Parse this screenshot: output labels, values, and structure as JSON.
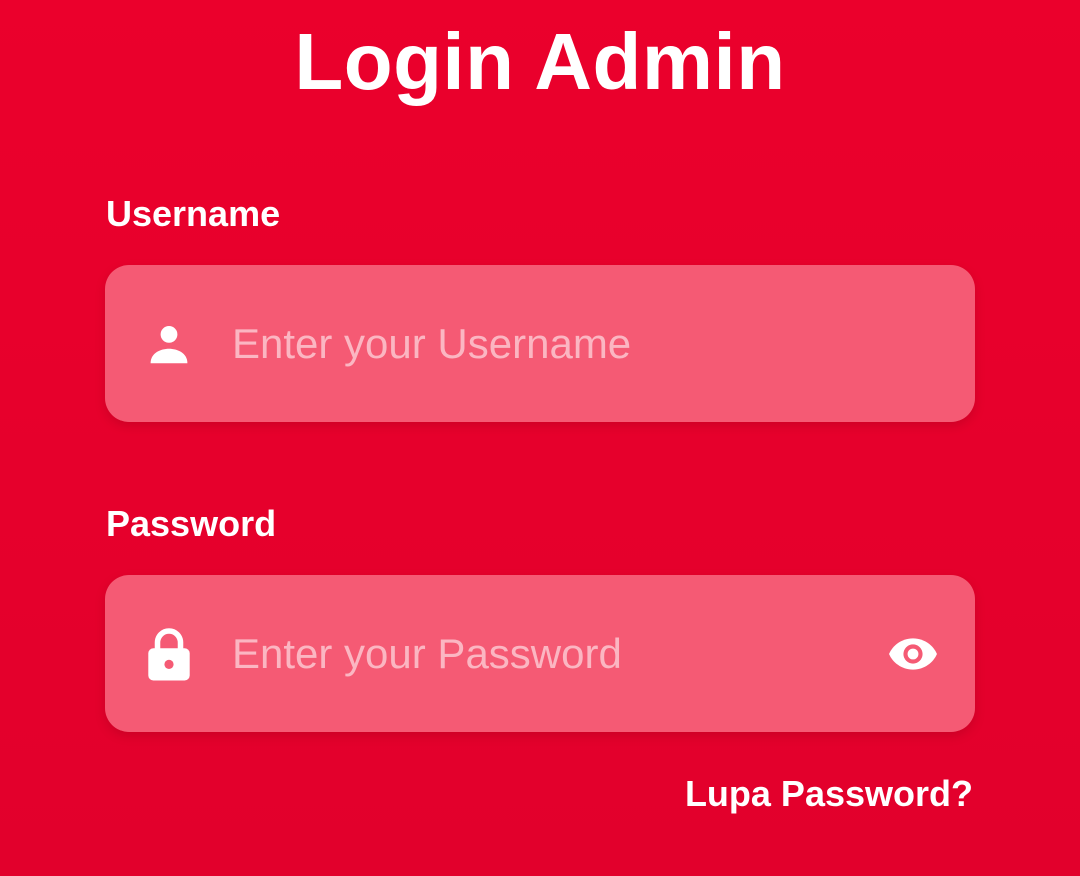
{
  "header": {
    "title": "Login Admin"
  },
  "form": {
    "username": {
      "label": "Username",
      "placeholder": "Enter your Username",
      "value": "",
      "icon": "person-icon"
    },
    "password": {
      "label": "Password",
      "placeholder": "Enter your Password",
      "value": "",
      "icon": "lock-icon",
      "toggle_icon": "eye-icon"
    },
    "forgot_password_label": "Lupa Password?"
  },
  "colors": {
    "background": "#e8002c",
    "field_background": "#f55a74",
    "placeholder": "#fbb6c2",
    "text": "#ffffff"
  }
}
